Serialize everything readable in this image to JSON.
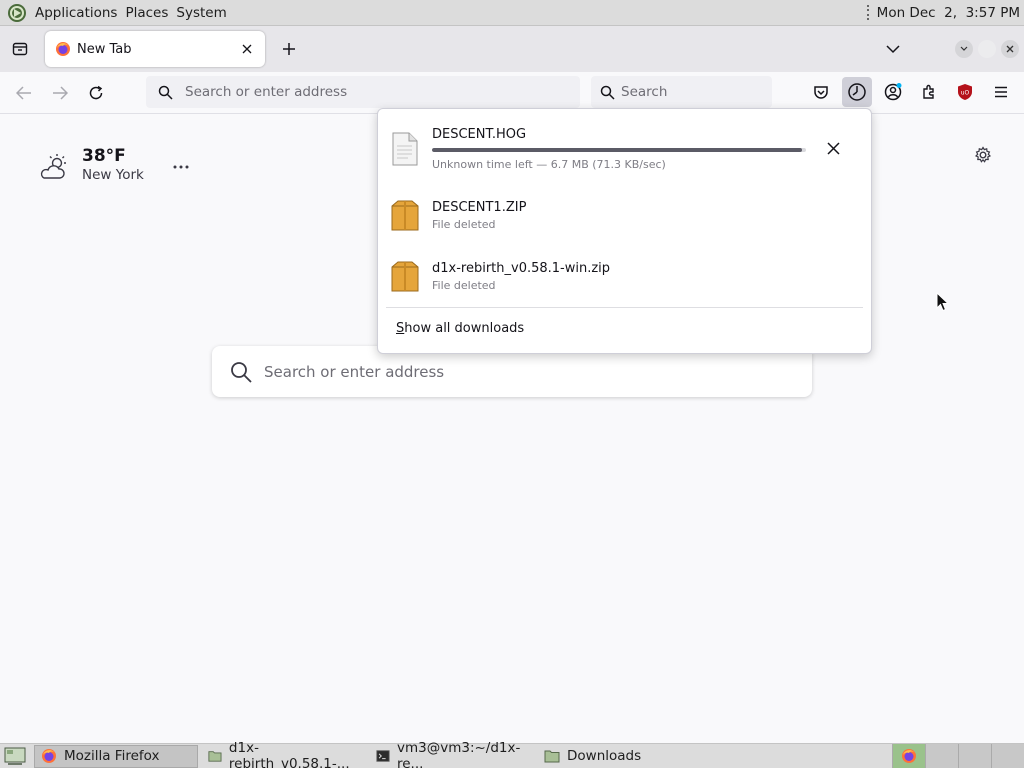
{
  "top_panel": {
    "menus": [
      "Applications",
      "Places",
      "System"
    ],
    "clock": "Mon Dec  2,  3:57 PM"
  },
  "tabs": [
    {
      "title": "New Tab"
    }
  ],
  "navbar": {
    "url_placeholder": "Search or enter address",
    "search_placeholder": "Search"
  },
  "newtab": {
    "weather": {
      "temp": "38°F",
      "city": "New York"
    },
    "search_placeholder": "Search or enter address"
  },
  "downloads": {
    "items": [
      {
        "name": "DESCENT.HOG",
        "status": "Unknown time left — 6.7 MB (71.3 KB/sec)",
        "in_progress": true,
        "progress": 0.99
      },
      {
        "name": "DESCENT1.ZIP",
        "status": "File deleted",
        "in_progress": false
      },
      {
        "name": "d1x-rebirth_v0.58.1-win.zip",
        "status": "File deleted",
        "in_progress": false
      }
    ],
    "show_all_prefix": "S",
    "show_all_rest": "how all downloads"
  },
  "taskbar": {
    "tasks": [
      {
        "label": "Mozilla Firefox",
        "icon": "firefox-icon",
        "active": true
      },
      {
        "label": "d1x-rebirth_v0.58.1-...",
        "icon": "folder-icon",
        "active": false
      },
      {
        "label": "vm3@vm3:~/d1x-re...",
        "icon": "terminal-icon",
        "active": false
      },
      {
        "label": "Downloads",
        "icon": "folder-icon",
        "active": false
      }
    ]
  },
  "colors": {
    "accent_progress": "#5b5b66",
    "panel_bg": "#dcdcdc",
    "ublock_red": "#b5121b"
  }
}
